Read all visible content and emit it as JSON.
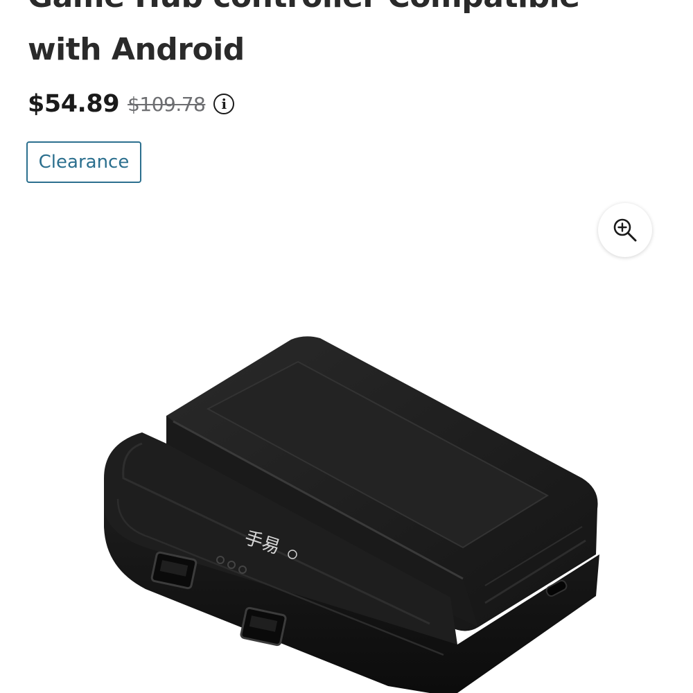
{
  "product": {
    "title": "Game Hub controller Compatible with Android",
    "price_current": "$54.89",
    "price_original": "$109.78",
    "badge": "Clearance",
    "image_logo_text": "手易"
  },
  "icons": {
    "info": "info-icon",
    "zoom": "zoom-in-icon"
  },
  "colors": {
    "badge": "#2b6f8e",
    "product_body": "#1b1b1b"
  }
}
